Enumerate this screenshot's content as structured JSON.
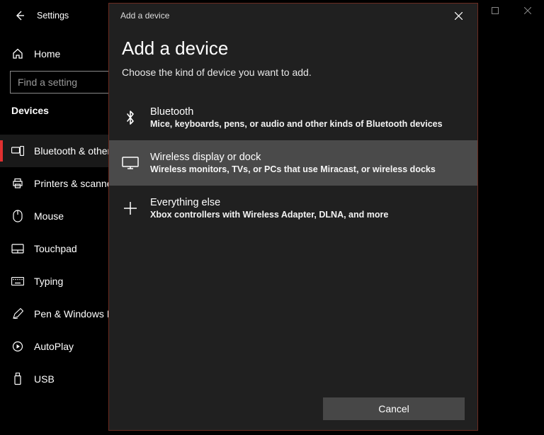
{
  "window": {
    "app_title": "Settings"
  },
  "sidebar": {
    "home_label": "Home",
    "search_placeholder": "Find a setting",
    "section_label": "Devices",
    "items": [
      {
        "label": "Bluetooth & other"
      },
      {
        "label": "Printers & scanners"
      },
      {
        "label": "Mouse"
      },
      {
        "label": "Touchpad"
      },
      {
        "label": "Typing"
      },
      {
        "label": "Pen & Windows Ink"
      },
      {
        "label": "AutoPlay"
      },
      {
        "label": "USB"
      }
    ]
  },
  "dialog": {
    "small_title": "Add a device",
    "big_title": "Add a device",
    "subtitle": "Choose the kind of device you want to add.",
    "options": [
      {
        "title": "Bluetooth",
        "desc": "Mice, keyboards, pens, or audio and other kinds of Bluetooth devices"
      },
      {
        "title": "Wireless display or dock",
        "desc": "Wireless monitors, TVs, or PCs that use Miracast, or wireless docks"
      },
      {
        "title": "Everything else",
        "desc": "Xbox controllers with Wireless Adapter, DLNA, and more"
      }
    ],
    "cancel_label": "Cancel"
  }
}
